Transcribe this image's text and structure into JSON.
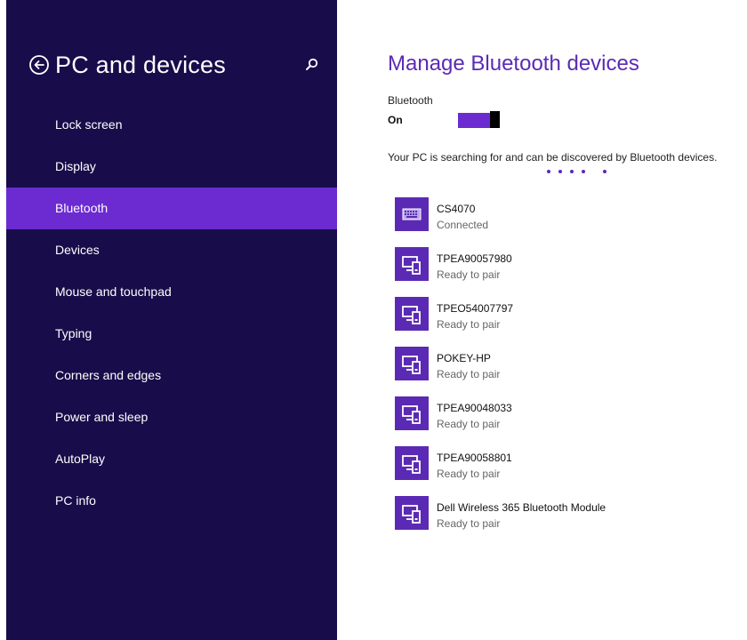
{
  "sidebar": {
    "title": "PC and devices",
    "items": [
      {
        "label": "Lock screen"
      },
      {
        "label": "Display"
      },
      {
        "label": "Bluetooth",
        "selected": true
      },
      {
        "label": "Devices"
      },
      {
        "label": "Mouse and touchpad"
      },
      {
        "label": "Typing"
      },
      {
        "label": "Corners and edges"
      },
      {
        "label": "Power and sleep"
      },
      {
        "label": "AutoPlay"
      },
      {
        "label": "PC info"
      }
    ]
  },
  "main": {
    "title": "Manage Bluetooth devices",
    "bluetooth_label": "Bluetooth",
    "bluetooth_state": "On",
    "status": "Your PC is searching for and can be discovered by Bluetooth devices.",
    "devices": [
      {
        "name": "CS4070",
        "status": "Connected",
        "icon": "keyboard-icon"
      },
      {
        "name": "TPEA90057980",
        "status": "Ready to pair",
        "icon": "devices-icon"
      },
      {
        "name": "TPEO54007797",
        "status": "Ready to pair",
        "icon": "devices-icon"
      },
      {
        "name": "POKEY-HP",
        "status": "Ready to pair",
        "icon": "devices-icon"
      },
      {
        "name": "TPEA90048033",
        "status": "Ready to pair",
        "icon": "devices-icon"
      },
      {
        "name": "TPEA90058801",
        "status": "Ready to pair",
        "icon": "devices-icon"
      },
      {
        "name": "Dell Wireless 365 Bluetooth Module",
        "status": "Ready to pair",
        "icon": "devices-icon"
      }
    ]
  },
  "colors": {
    "sidebar_bg": "#180d4a",
    "accent": "#6b2bd1",
    "tile": "#5b2ab5"
  }
}
